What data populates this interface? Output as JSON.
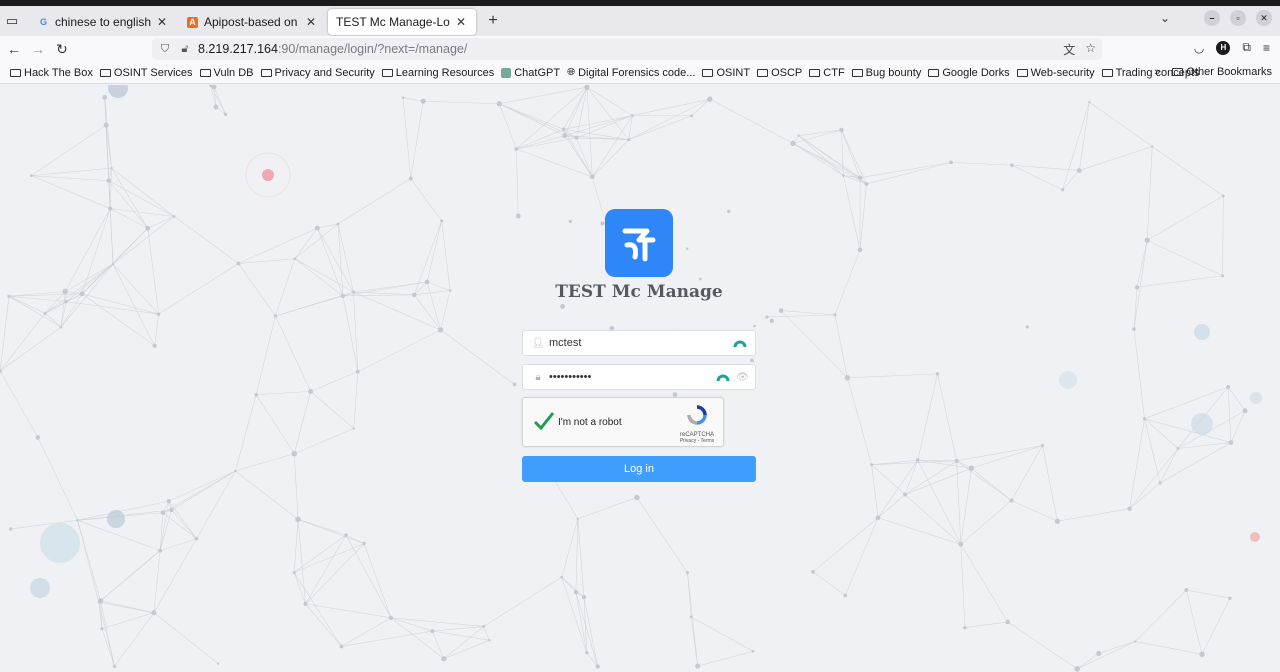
{
  "browser": {
    "tabs": [
      {
        "title": "chinese to english - Goo",
        "favicon": "G",
        "favicon_color": "#4285f4",
        "active": false
      },
      {
        "title": "Apipost-based on collab",
        "favicon": "A",
        "favicon_color": "#f36b21",
        "active": false
      },
      {
        "title": "TEST Mc Manage-Log in",
        "favicon": "",
        "favicon_color": "",
        "active": true
      }
    ],
    "url_host": "8.219.217.164",
    "url_path": ":90/manage/login/?next=/manage/",
    "avatar_letter": "H",
    "bookmarks": [
      {
        "label": "Hack The Box",
        "icon": "folder-icon"
      },
      {
        "label": "OSINT Services",
        "icon": "folder-icon"
      },
      {
        "label": "Vuln DB",
        "icon": "folder-icon"
      },
      {
        "label": "Privacy and Security",
        "icon": "folder-icon"
      },
      {
        "label": "Learning Resources",
        "icon": "folder-icon"
      },
      {
        "label": "ChatGPT",
        "icon": "chatgpt-icon"
      },
      {
        "label": "Digital Forensics code...",
        "icon": "globe-icon"
      },
      {
        "label": "OSINT",
        "icon": "folder-icon"
      },
      {
        "label": "OSCP",
        "icon": "folder-icon"
      },
      {
        "label": "CTF",
        "icon": "folder-icon"
      },
      {
        "label": "Bug bounty",
        "icon": "folder-icon"
      },
      {
        "label": "Google Dorks",
        "icon": "folder-icon"
      },
      {
        "label": "Web-security",
        "icon": "folder-icon"
      },
      {
        "label": "Trading concepts",
        "icon": "folder-icon"
      }
    ],
    "overflow_label": "»",
    "other_bookmarks": "Other Bookmarks"
  },
  "login": {
    "app_title": "TEST Mc Manage",
    "username_value": "mctest",
    "password_value": "•••••••••••",
    "captcha_label": "I'm not a robot",
    "captcha_brand": "reCAPTCHA",
    "captcha_links": "Privacy - Terms",
    "captcha_checked": true,
    "submit_label": "Log in",
    "accent_color": "#409eff",
    "logo_color": "#2f86f6"
  }
}
